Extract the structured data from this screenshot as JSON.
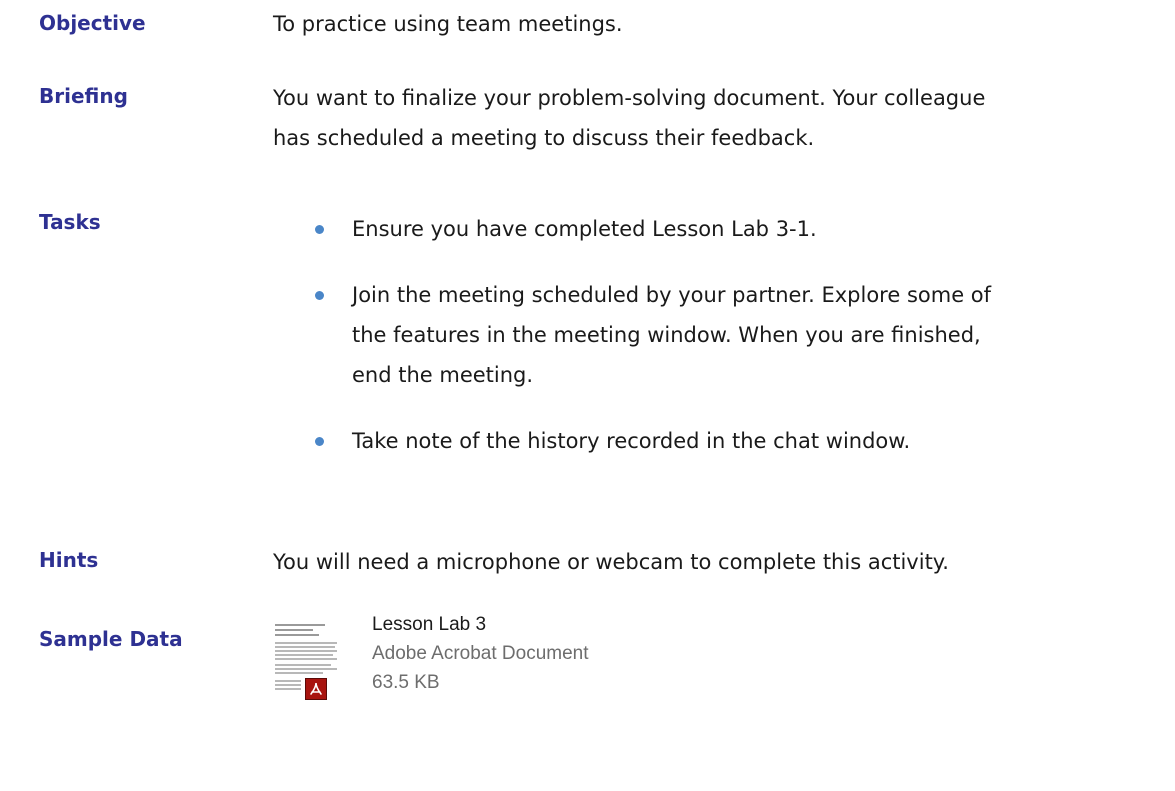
{
  "sections": {
    "objective": {
      "label": "Objective",
      "text": "To practice using team meetings."
    },
    "briefing": {
      "label": "Briefing",
      "line1": "You want to finalize your problem-solving document. Your colleague",
      "line2": "has scheduled a meeting to discuss their feedback."
    },
    "tasks": {
      "label": "Tasks",
      "items": [
        {
          "lines": [
            "Ensure you have completed Lesson Lab 3-1."
          ]
        },
        {
          "lines": [
            "Join the meeting scheduled by your partner. Explore some of",
            "the features in the meeting window. When you are finished,",
            "end the meeting."
          ]
        },
        {
          "lines": [
            "Take note of the history recorded in the chat window."
          ]
        }
      ]
    },
    "hints": {
      "label": "Hints",
      "text": "You will need a microphone or webcam to complete this activity."
    },
    "sample_data": {
      "label": "Sample Data",
      "file": {
        "name": "Lesson Lab 3",
        "type": "Adobe Acrobat Document",
        "size": "63.5 KB",
        "icon": "pdf-file-icon"
      }
    }
  },
  "colors": {
    "label": "#2e3192",
    "bullet": "#4a86c8",
    "body": "#1a1a1a",
    "muted": "#6d6d6d",
    "pdf_badge": "#a8140f"
  }
}
